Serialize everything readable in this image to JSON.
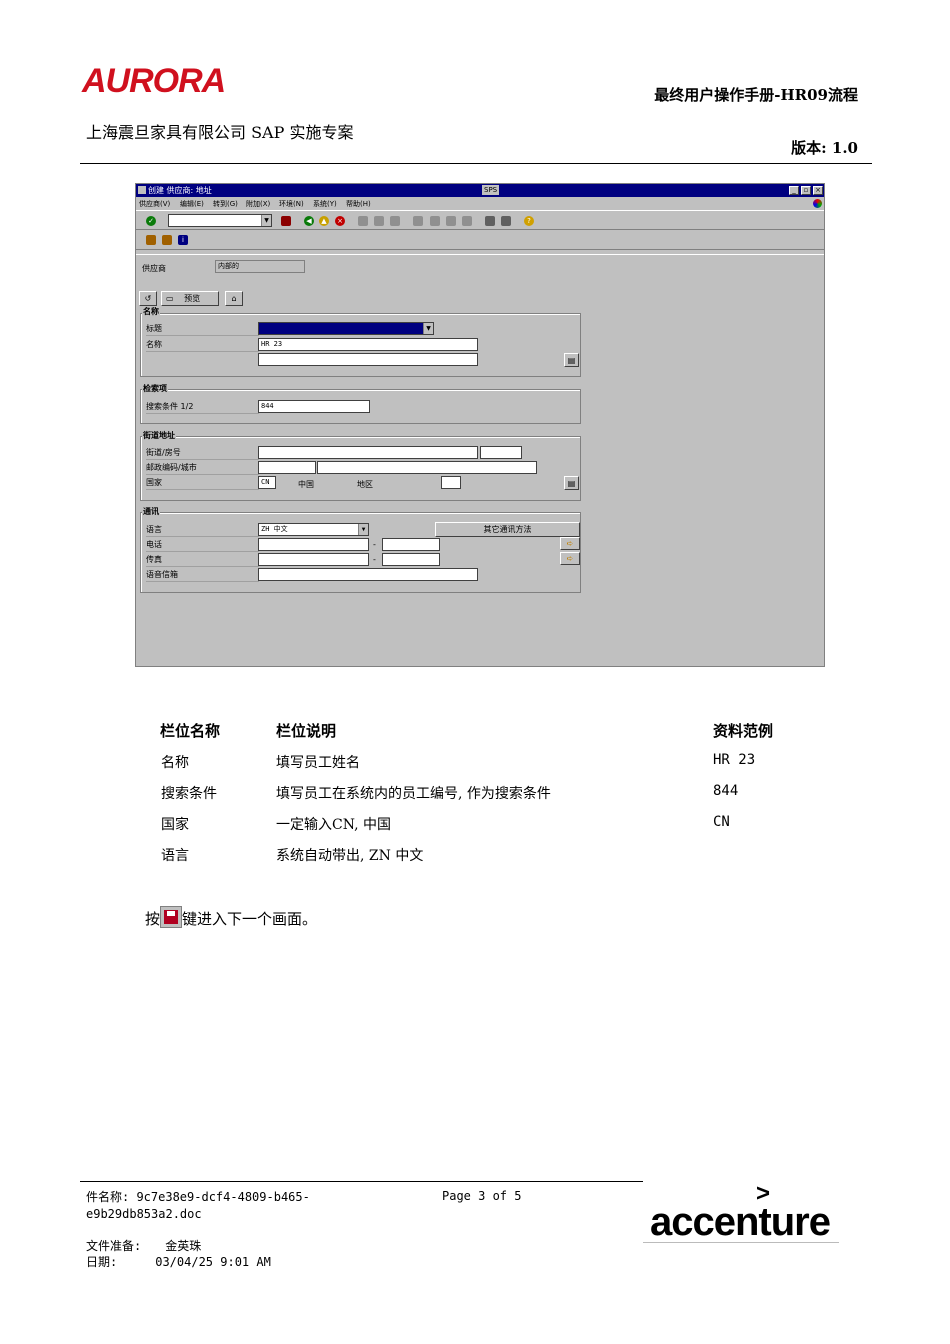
{
  "header": {
    "logo": "AURORA",
    "doc_title": "最终用户操作手册-HR09流程",
    "company": "上海震旦家具有限公司 SAP 实施专案",
    "version": "版本: 1.0"
  },
  "sap": {
    "title": "创建 供应商: 地址",
    "sys": "SPS",
    "menu": [
      "供应商(V)",
      "编辑(E)",
      "转到(G)",
      "附加(X)",
      "环境(N)",
      "系统(Y)",
      "帮助(H)"
    ],
    "vendor_label": "供应商",
    "vendor_value": "内部的",
    "preview_label": "预览",
    "name_frame": "名称",
    "title_label": "标题",
    "name_label": "名称",
    "name_value": "HR 23",
    "search_frame": "检索项",
    "search_label": "搜索条件 1/2",
    "search_value": "844",
    "street_frame": "街道地址",
    "street_label": "街道/房号",
    "postal_label": "邮政编码/城市",
    "country_label": "国家",
    "country_value": "CN",
    "country_name": "中国",
    "region_label": "地区",
    "comm_frame": "通讯",
    "language_label": "语言",
    "language_value": "ZH 中文",
    "other_comm_button": "其它通讯方法",
    "phone_label": "电话",
    "fax_label": "传真",
    "voicemail_label": "语音信箱"
  },
  "table": {
    "headers": [
      "栏位名称",
      "栏位说明",
      "资料范例"
    ],
    "rows": [
      [
        "名称",
        "填写员工姓名",
        "HR 23"
      ],
      [
        "搜索条件",
        "填写员工在系统内的员工编号, 作为搜索条件",
        "844"
      ],
      [
        "国家",
        "一定输入CN, 中国",
        "CN"
      ],
      [
        "语言",
        "系统自动带出, ZN 中文",
        ""
      ]
    ]
  },
  "instruction": {
    "prefix": "按",
    "suffix": "键进入下一个画面。"
  },
  "footer": {
    "file": "件名称: 9c7e38e9-dcf4-4809-b465-e9b29db853a2.doc",
    "page": "Page 3 of 5",
    "prepared_by_label": "文件准备:",
    "prepared_by": "金英珠",
    "date_label": "日期:",
    "date": "03/04/25 9:01 AM",
    "brand": "accenture",
    "brand_mark": ">"
  }
}
